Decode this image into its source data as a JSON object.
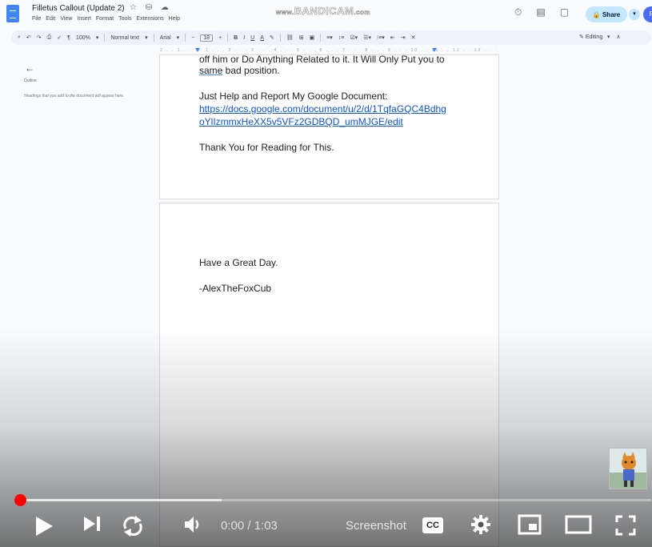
{
  "docs": {
    "title": "Filletus Callout (Update 2)",
    "title_icons": "☆ ⛁ ☁",
    "menu": [
      "File",
      "Edit",
      "View",
      "Insert",
      "Format",
      "Tools",
      "Extensions",
      "Help"
    ],
    "share_label": "Share",
    "avatar_letter": "F",
    "toolbar": {
      "zoom": "100%",
      "style": "Normal text",
      "font": "Arial",
      "font_size": "18",
      "mode": "Editing"
    },
    "ruler_text": "2 . . 1 . . . . 1 . . . 2 . . . 3 . . . 4 . . . 5 . . . 6 . . . 7 . . . 8 . . . 9 . . . 10 . . 11 . . 12 . . 13 . . 14 . . 15 . . 16 . . 17 . . 18 . . 19",
    "outline": {
      "title": "Outline",
      "hint": "Headings that you add to the document will appear here."
    }
  },
  "watermark": {
    "prefix": "www.",
    "main": "BANDICAM",
    "suffix": ".com"
  },
  "page1": {
    "cut_line": "off him or Do Anything Related to it. It Will Only Put you to",
    "line2_underlined": "same",
    "line2_rest": " bad position.",
    "report_label": "Just Help and Report My Google Document:",
    "link_line1": "https://docs.google.com/document/u/2/d/1TqfaGQC4Bdhg",
    "link_line2": "oYlIzmmxHeXX5v5VFz2GDBQD_umMJGE/edit",
    "thanks": "Thank You for Reading for This."
  },
  "page2": {
    "greeting": "Have a Great Day.",
    "signature": "-AlexTheFoxCub"
  },
  "player": {
    "time": "0:00 / 1:03",
    "screenshot_label": "Screenshot",
    "cc_label": "CC",
    "progress_played": 0,
    "progress_buffered": 0.32
  }
}
